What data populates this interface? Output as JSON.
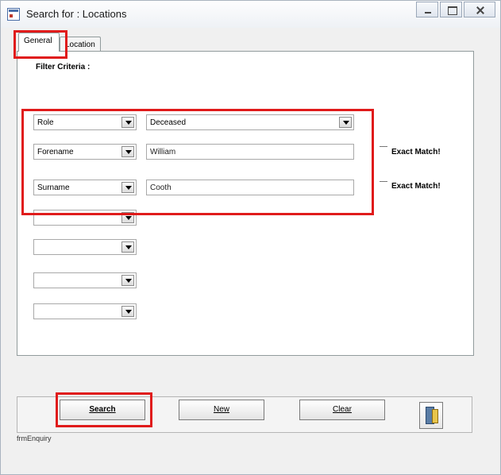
{
  "window": {
    "title": "Search for : Locations"
  },
  "tabs": [
    {
      "label": "General"
    },
    {
      "label": "Location"
    }
  ],
  "filter_label": "Filter Criteria :",
  "criteria": [
    {
      "field": "Role",
      "value": "Deceased",
      "value_type": "combo"
    },
    {
      "field": "Forename",
      "value": "William",
      "value_type": "text",
      "exact_label": "Exact Match!"
    },
    {
      "field": "Surname",
      "value": "Cooth",
      "value_type": "text",
      "exact_label": "Exact Match!"
    },
    {
      "field": ""
    },
    {
      "field": ""
    },
    {
      "field": ""
    },
    {
      "field": ""
    }
  ],
  "buttons": {
    "search": "Search",
    "new": "New",
    "clear": "Clear"
  },
  "icons": {
    "exit": "door-exit-icon",
    "app": "form-icon"
  },
  "status_text": "frmEnquiry",
  "colors": {
    "highlight": "#e01b1b"
  }
}
